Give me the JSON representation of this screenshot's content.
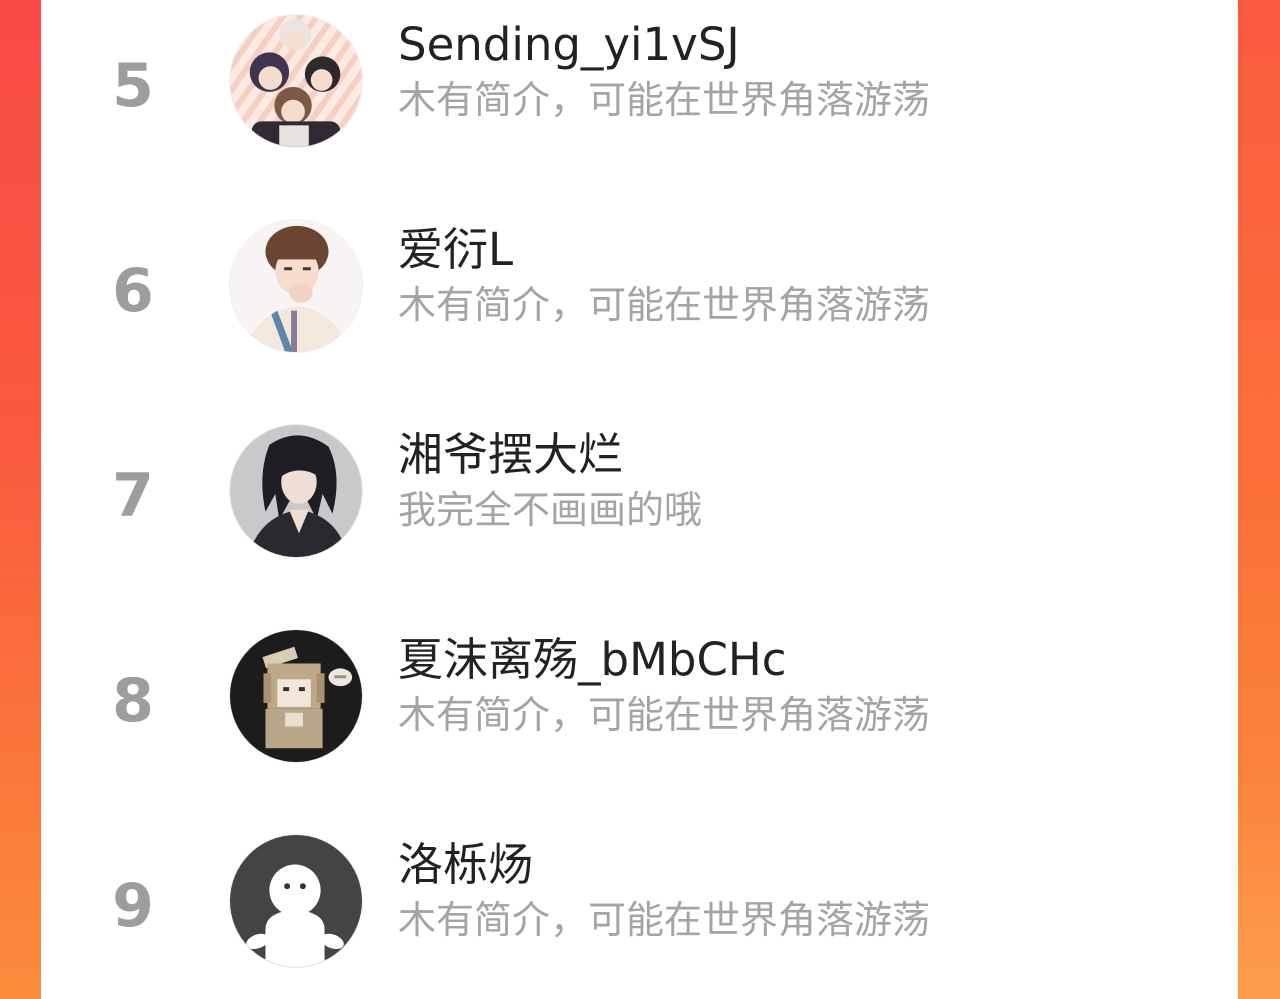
{
  "leaderboard": {
    "entries": [
      {
        "rank": "5",
        "name": "Sending_yi1vSJ",
        "bio": "木有简介，可能在世界角落游荡",
        "avatar_icon": "anime-group-avatar-icon"
      },
      {
        "rank": "6",
        "name": "爱衍L",
        "bio": "木有简介，可能在世界角落游荡",
        "avatar_icon": "anime-boy-avatar-icon"
      },
      {
        "rank": "7",
        "name": "湘爷摆大烂",
        "bio": "我完全不画画的哦",
        "avatar_icon": "dark-hair-character-avatar-icon"
      },
      {
        "rank": "8",
        "name": "夏沫离殇_bMbCHc",
        "bio": "木有简介，可能在世界角落游荡",
        "avatar_icon": "pixel-character-avatar-icon"
      },
      {
        "rank": "9",
        "name": "洛栎炀",
        "bio": "木有简介，可能在世界角落游荡",
        "avatar_icon": "default-ghost-avatar-icon"
      }
    ]
  },
  "colors": {
    "background_gradient_top": "#f94a45",
    "background_gradient_bottom": "#fc8c3b",
    "rank_text": "#9d9d9d",
    "name_text": "#222222",
    "bio_text": "#a4a4a4",
    "panel": "#ffffff"
  }
}
